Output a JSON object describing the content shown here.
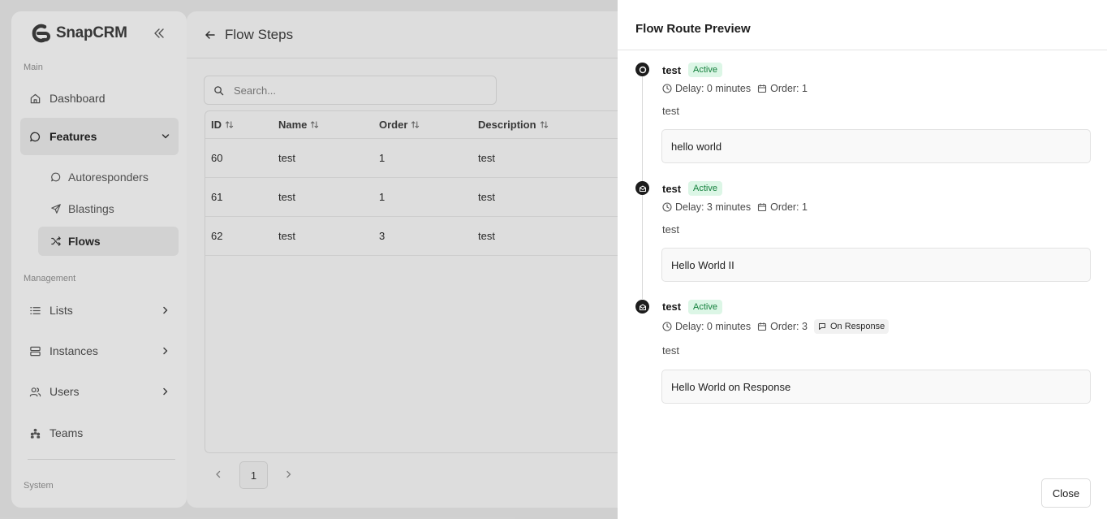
{
  "app": {
    "name": "SnapCRM"
  },
  "sidebar": {
    "sections": {
      "main": "Main",
      "management": "Management",
      "system": "System"
    },
    "items": {
      "dashboard": "Dashboard",
      "features": "Features",
      "autoresponders": "Autoresponders",
      "blastings": "Blastings",
      "flows": "Flows",
      "lists": "Lists",
      "instances": "Instances",
      "users": "Users",
      "teams": "Teams"
    }
  },
  "page": {
    "title": "Flow Steps",
    "search_placeholder": "Search...",
    "table": {
      "headers": {
        "id": "ID",
        "name": "Name",
        "order": "Order",
        "description": "Description"
      },
      "rows": [
        {
          "id": "60",
          "name": "test",
          "order": "1",
          "description": "test"
        },
        {
          "id": "61",
          "name": "test",
          "order": "1",
          "description": "test"
        },
        {
          "id": "62",
          "name": "test",
          "order": "3",
          "description": "test"
        }
      ]
    },
    "pagination": {
      "current_page": "1"
    }
  },
  "panel": {
    "title": "Flow Route Preview",
    "steps": [
      {
        "name": "test",
        "status": "Active",
        "delay": "Delay: 0 minutes",
        "order": "Order: 1",
        "description": "test",
        "message": "hello world",
        "icon": "circle-icon"
      },
      {
        "name": "test",
        "status": "Active",
        "delay": "Delay: 3 minutes",
        "order": "Order: 1",
        "description": "test",
        "message": "Hello World II",
        "icon": "mail-open-icon"
      },
      {
        "name": "test",
        "status": "Active",
        "delay": "Delay: 0 minutes",
        "order": "Order: 3",
        "trigger": "On Response",
        "description": "test",
        "message": "Hello World on Response",
        "icon": "mail-open-icon"
      }
    ],
    "close_label": "Close"
  },
  "colors": {
    "active_badge_bg": "#dcf6e6",
    "active_badge_text": "#15803d",
    "timeline_dot": "#1d1d1d"
  }
}
